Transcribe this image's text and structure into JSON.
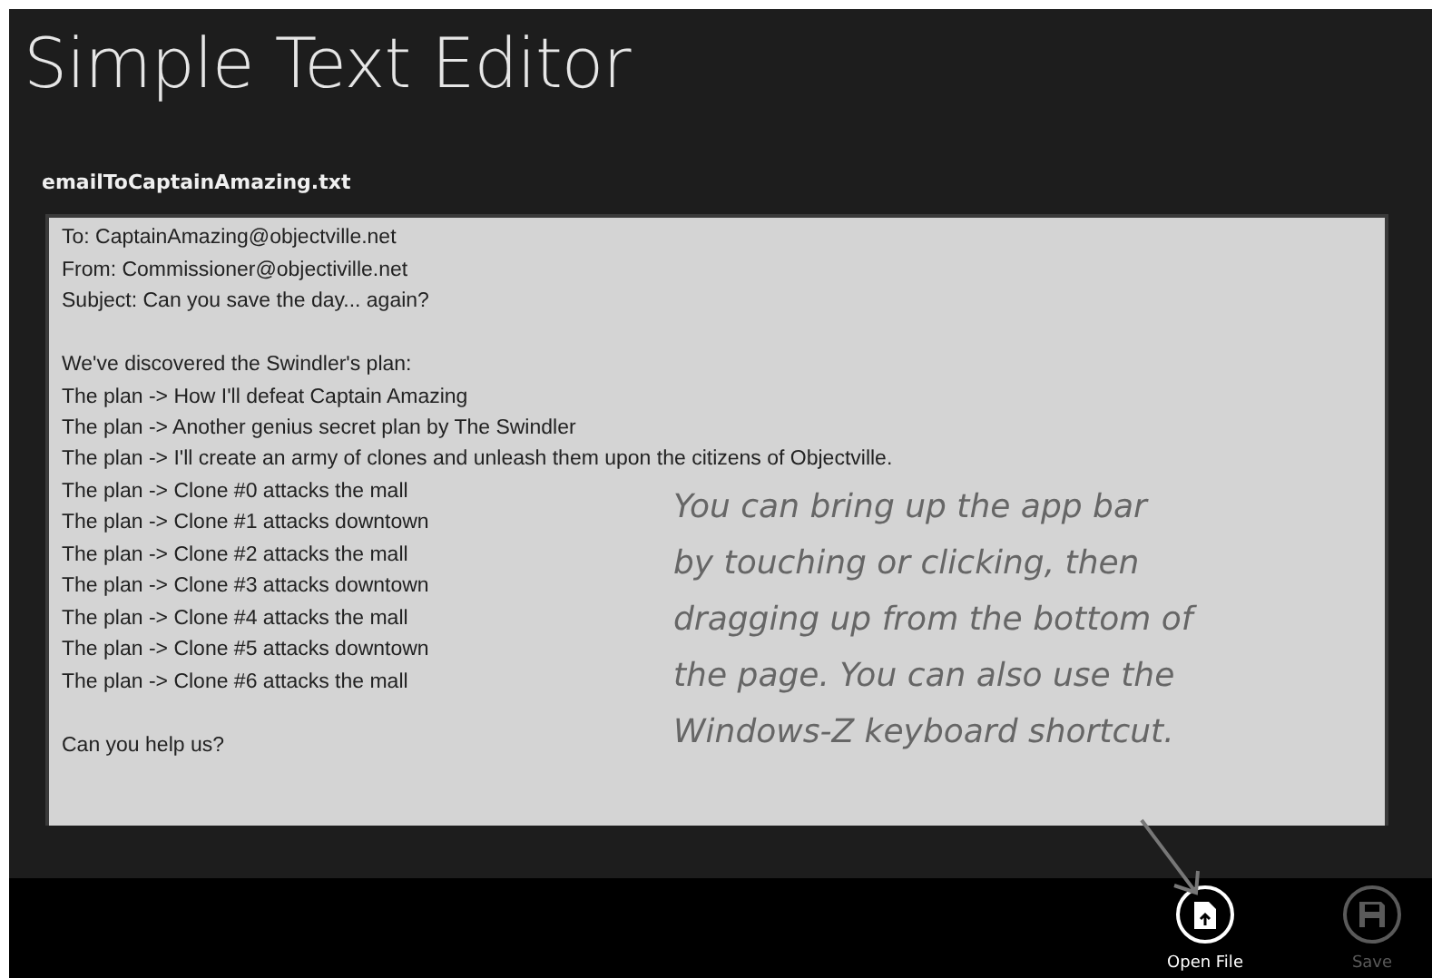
{
  "app": {
    "title": "Simple Text Editor"
  },
  "file_name": "emailToCaptainAmazing.txt",
  "editor": {
    "value": "To: CaptainAmazing@objectville.net\nFrom: Commissioner@objectiville.net\nSubject: Can you save the day... again?\n\nWe've discovered the Swindler's plan:\nThe plan -> How I'll defeat Captain Amazing\nThe plan -> Another genius secret plan by The Swindler\nThe plan -> I'll create an army of clones and unleash them upon the citizens of Objectville.\nThe plan -> Clone #0 attacks the mall\nThe plan -> Clone #1 attacks downtown\nThe plan -> Clone #2 attacks the mall\nThe plan -> Clone #3 attacks downtown\nThe plan -> Clone #4 attacks the mall\nThe plan -> Clone #5 attacks downtown\nThe plan -> Clone #6 attacks the mall\n\nCan you help us?"
  },
  "annotation": {
    "lines": [
      "You can bring up the app bar",
      "by touching or clicking, then",
      "dragging up from the bottom of",
      "the page. You can also use the",
      "Windows-Z keyboard shortcut."
    ]
  },
  "app_bar": {
    "buttons": [
      {
        "kind": "open",
        "label": "Open File",
        "disabled": false
      },
      {
        "kind": "save",
        "label": "Save",
        "disabled": true
      }
    ]
  }
}
